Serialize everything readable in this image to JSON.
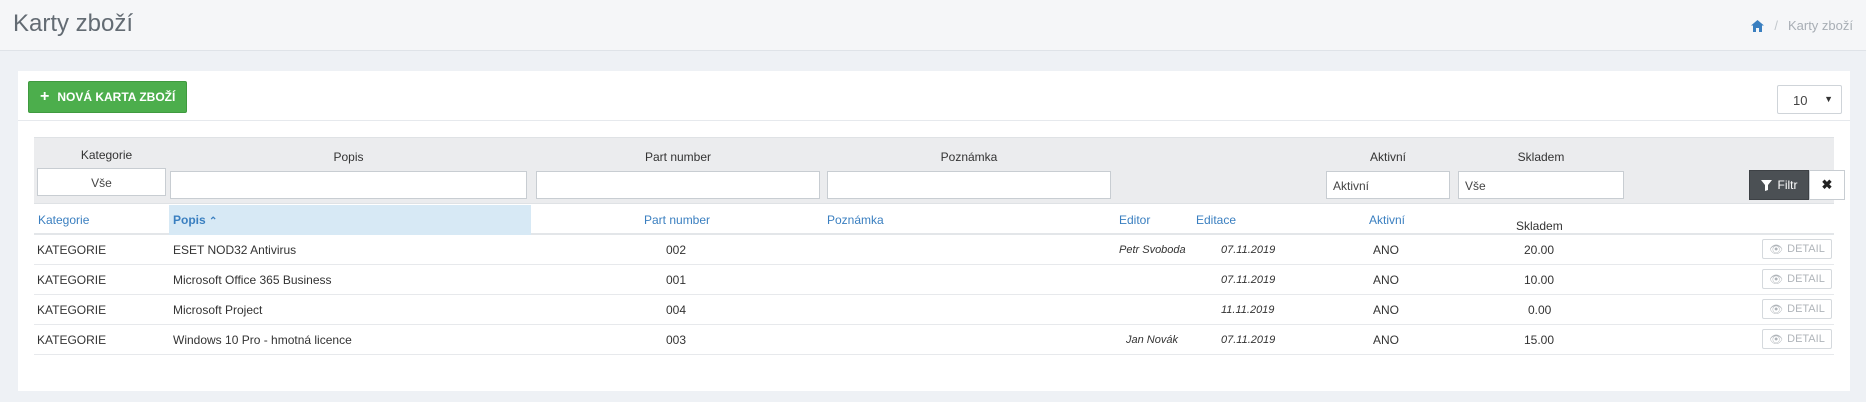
{
  "header": {
    "title": "Karty zboží",
    "breadcrumb_current": "Karty zboží",
    "breadcrumb_sep": "/"
  },
  "toolbar": {
    "new_button_label": "NOVÁ KARTA ZBOŽÍ",
    "page_size": "10"
  },
  "filters": {
    "kategorie_label": "Kategorie",
    "kategorie_value": "Vše",
    "popis_label": "Popis",
    "part_label": "Part number",
    "poznamka_label": "Poznámka",
    "aktivni_label": "Aktivní",
    "aktivni_placeholder": "Aktivní",
    "skladem_label": "Skladem",
    "skladem_placeholder": "Vše",
    "filter_button": "Filtr"
  },
  "columns": {
    "kategorie": "Kategorie",
    "popis": "Popis",
    "part": "Part number",
    "poznamka": "Poznámka",
    "editor": "Editor",
    "editace": "Editace",
    "aktivni": "Aktivní",
    "skladem": "Skladem"
  },
  "rows": [
    {
      "kategorie": "KATEGORIE",
      "popis": "ESET NOD32 Antivirus",
      "part": "002",
      "editor": "Petr Svoboda",
      "editace": "07.11.2019",
      "aktivni": "ANO",
      "skladem": "20.00",
      "detail": "DETAIL"
    },
    {
      "kategorie": "KATEGORIE",
      "popis": "Microsoft Office 365 Business",
      "part": "001",
      "editor": "",
      "editace": "07.11.2019",
      "aktivni": "ANO",
      "skladem": "10.00",
      "detail": "DETAIL"
    },
    {
      "kategorie": "KATEGORIE",
      "popis": "Microsoft Project",
      "part": "004",
      "editor": "",
      "editace": "11.11.2019",
      "aktivni": "ANO",
      "skladem": "0.00",
      "detail": "DETAIL"
    },
    {
      "kategorie": "KATEGORIE",
      "popis": "Windows 10 Pro - hmotná licence",
      "part": "003",
      "editor": "Jan Novák",
      "editace": "07.11.2019",
      "aktivni": "ANO",
      "skladem": "15.00",
      "detail": "DETAIL"
    }
  ],
  "colors": {
    "accent": "#3a7fc0",
    "success": "#4cae4c",
    "dark_button": "#4b5054"
  }
}
